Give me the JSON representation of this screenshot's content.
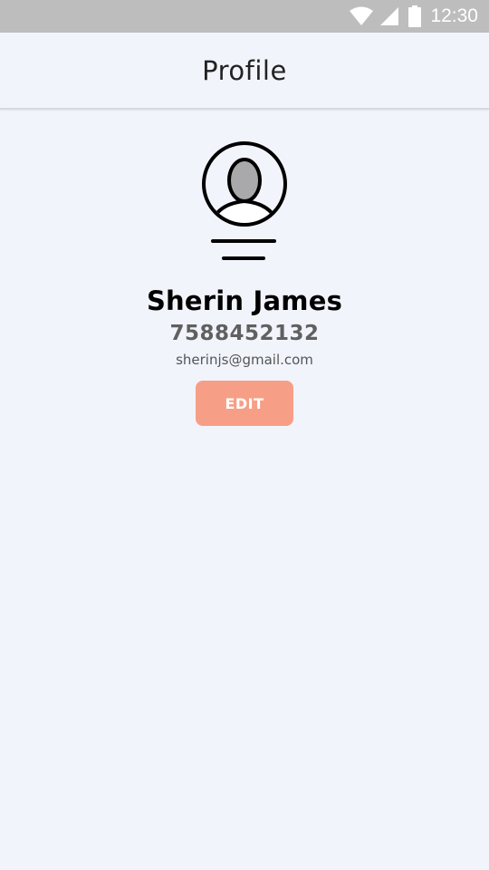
{
  "status_bar": {
    "time": "12:30",
    "icons": [
      "wifi-icon",
      "signal-icon",
      "battery-icon"
    ]
  },
  "header": {
    "title": "Profile"
  },
  "profile": {
    "avatar_icon": "user-avatar-icon",
    "name": "Sherin James",
    "phone": "7588452132",
    "email": "sherinjs@gmail.com",
    "edit_label": "EDIT"
  },
  "colors": {
    "background": "#f2f4fc",
    "status_bar": "#bdbdbd",
    "accent": "#f79f86",
    "phone_text": "#606060"
  }
}
